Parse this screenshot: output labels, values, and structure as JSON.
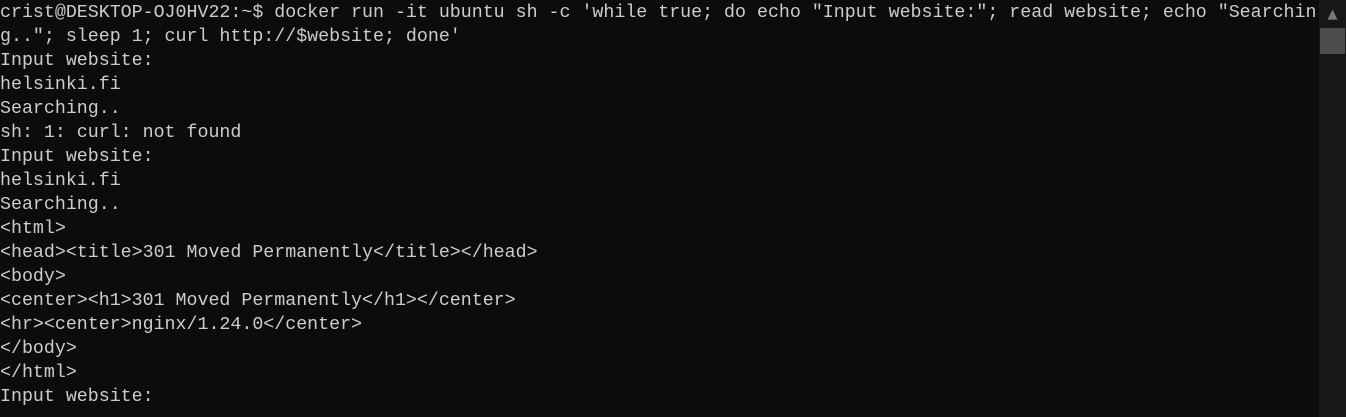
{
  "terminal": {
    "lines": [
      "crist@DESKTOP-OJ0HV22:~$ docker run -it ubuntu sh -c 'while true; do echo \"Input website:\"; read website; echo \"Searchin",
      "g..\"; sleep 1; curl http://$website; done'",
      "Input website:",
      "helsinki.fi",
      "Searching..",
      "sh: 1: curl: not found",
      "Input website:",
      "helsinki.fi",
      "Searching..",
      "<html>",
      "<head><title>301 Moved Permanently</title></head>",
      "<body>",
      "<center><h1>301 Moved Permanently</h1></center>",
      "<hr><center>nginx/1.24.0</center>",
      "</body>",
      "</html>",
      "Input website:"
    ]
  },
  "scrollbar": {
    "up_icon": "chevron-up-icon"
  },
  "colors": {
    "background": "#0c0c0c",
    "text": "#cccccc",
    "scrollbar": "#171717",
    "thumb": "#4d4d4d"
  }
}
